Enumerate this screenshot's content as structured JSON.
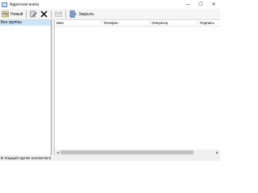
{
  "window": {
    "title": "Адресная книга",
    "minimize": "—",
    "maximize": "☐",
    "close": "✕"
  },
  "toolbar": {
    "new_label": "Новый",
    "close_label": "Закрыть"
  },
  "groups": {
    "items": [
      {
        "label": "Без группы",
        "selected": true
      }
    ]
  },
  "list": {
    "columns": [
      "Имя",
      "Телефон",
      "Оператор",
      "Подпись"
    ]
  },
  "status": {
    "text": "В текущей группе контактов:0"
  },
  "colors": {
    "accent": "#cce4f7",
    "scroll_thumb": "#c1c1c1"
  }
}
